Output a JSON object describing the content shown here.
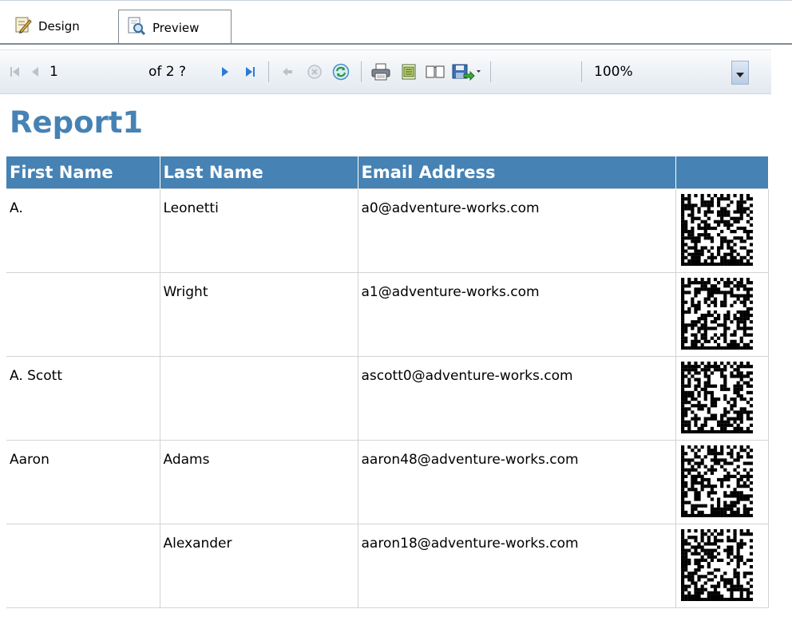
{
  "tabs": [
    {
      "label": "Design",
      "icon": "design-pencil-icon"
    },
    {
      "label": "Preview",
      "icon": "preview-magnifier-icon",
      "active": true
    }
  ],
  "toolbar": {
    "current_page": "1",
    "of_pages": "of 2 ?",
    "zoom": "100%",
    "buttons": [
      "first-page-icon",
      "previous-page-icon",
      "next-page-icon",
      "last-page-icon",
      "back-icon",
      "stop-icon",
      "refresh-icon",
      "print-icon",
      "print-layout-icon",
      "page-setup-icon",
      "export-icon"
    ]
  },
  "report": {
    "title": "Report1",
    "columns": [
      "First Name",
      "Last Name",
      "Email Address",
      ""
    ],
    "rows": [
      {
        "first": "A.",
        "last": "Leonetti",
        "email": "a0@adventure-works.com"
      },
      {
        "first": "",
        "last": "Wright",
        "email": "a1@adventure-works.com"
      },
      {
        "first": "A. Scott",
        "last": "",
        "email": "ascott0@adventure-works.com"
      },
      {
        "first": "Aaron",
        "last": "Adams",
        "email": "aaron48@adventure-works.com"
      },
      {
        "first": "",
        "last": "Alexander",
        "email": "aaron18@adventure-works.com"
      }
    ]
  },
  "colors": {
    "accent": "#4682b4",
    "header_text": "#ffffff",
    "grid_line": "#d3d3d3"
  }
}
